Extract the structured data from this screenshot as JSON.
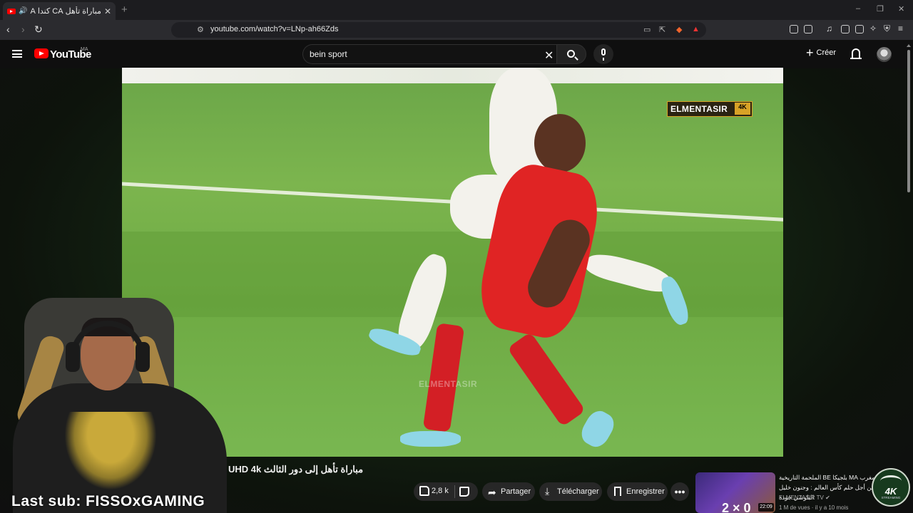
{
  "browser": {
    "tab_title": "مباراة تأهل CA كندا MA المغرب",
    "new_tab": "+",
    "url": "youtube.com/watch?v=LNp-ah66Zds",
    "window_controls": [
      "–",
      "❐",
      "✕"
    ]
  },
  "youtube": {
    "brand": "YouTube",
    "country": "MA",
    "search_value": "bein sport",
    "create_label": "Créer",
    "player": {
      "watermark": "ELMENTASIR",
      "watermark_badge": "4K",
      "watermark_center": "ELMENTASIR"
    },
    "video": {
      "title": "مباراة تأهل إلى دور الثالث UHD 4k",
      "likes": "2,8 k",
      "share_label": "Partager",
      "download_label": "Télécharger",
      "save_label": "Enregistrer",
      "more_label": "•••"
    },
    "recommended": {
      "title": "المغرب MA بلجيكا BE الملحمة التاريخية من أجل حلم كأس العالم : وجنون خليل البلوشي جودة",
      "channel": "ELMENTASIR TV",
      "meta": "1 M de vues · il y a 10 mois",
      "score": "2 × 0",
      "duration": "22:09"
    }
  },
  "stream_overlay": {
    "last_sub": "Last sub: FISSOxGAMING",
    "badge_text": "4K",
    "badge_sub": "STREAMING"
  },
  "colors": {
    "accent": "#ff0000",
    "background": "#0f0f0f",
    "watermark_gold": "#d8a226"
  }
}
